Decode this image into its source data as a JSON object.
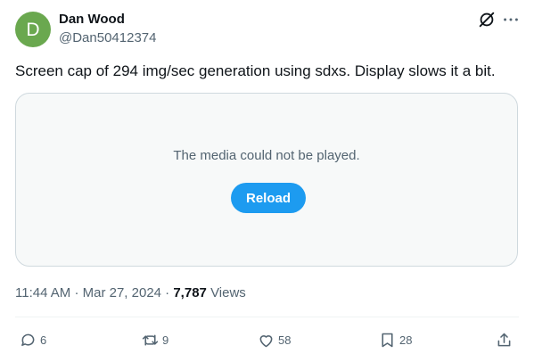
{
  "author": {
    "avatar_letter": "D",
    "avatar_color": "#6aa84f",
    "name": "Dan Wood",
    "handle": "@Dan50412374"
  },
  "icons": {
    "grok": "grok-slash-circle-icon",
    "more": "more-horizontal-icon",
    "reply": "reply-bubble-icon",
    "retweet": "retweet-icon",
    "like": "heart-icon",
    "bookmark": "bookmark-icon",
    "share": "share-upload-icon"
  },
  "tweet": {
    "text": "Screen cap of 294 img/sec generation using sdxs.  Display slows it a bit."
  },
  "media": {
    "error_message": "The media could not be played.",
    "reload_label": "Reload"
  },
  "meta": {
    "time": "11:44 AM",
    "date": "Mar 27, 2024",
    "views_count": "7,787",
    "views_label": "Views"
  },
  "actions": {
    "replies": "6",
    "retweets": "9",
    "likes": "58",
    "bookmarks": "28"
  },
  "colors": {
    "accent": "#1d9bf0",
    "secondary_text": "#536471",
    "border": "#cfd9de"
  }
}
